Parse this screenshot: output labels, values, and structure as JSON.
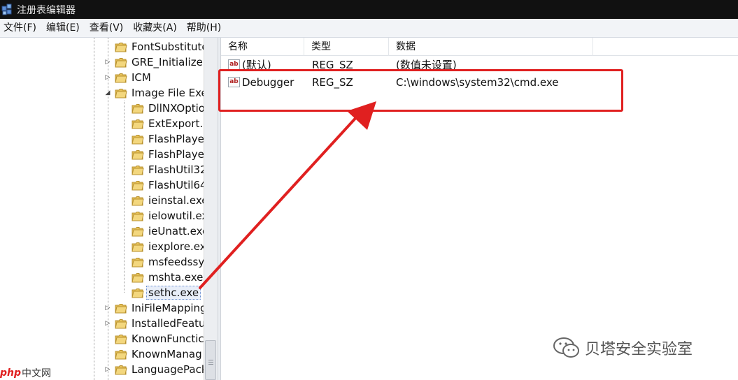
{
  "window": {
    "title": "注册表编辑器"
  },
  "menu": [
    "文件(F)",
    "编辑(E)",
    "查看(V)",
    "收藏夹(A)",
    "帮助(H)"
  ],
  "tree": {
    "items": [
      {
        "label": "FontSubstitute",
        "level": 1,
        "expander": "none"
      },
      {
        "label": "GRE_Initialize",
        "level": 1,
        "expander": "collapsed"
      },
      {
        "label": "ICM",
        "level": 1,
        "expander": "collapsed"
      },
      {
        "label": "Image File Exe",
        "level": 1,
        "expander": "expanded"
      },
      {
        "label": "DllNXOptio",
        "level": 2,
        "expander": "none"
      },
      {
        "label": "ExtExport.e",
        "level": 2,
        "expander": "none"
      },
      {
        "label": "FlashPlayer",
        "level": 2,
        "expander": "none"
      },
      {
        "label": "FlashPlayer",
        "level": 2,
        "expander": "none"
      },
      {
        "label": "FlashUtil32",
        "level": 2,
        "expander": "none"
      },
      {
        "label": "FlashUtil64",
        "level": 2,
        "expander": "none"
      },
      {
        "label": "ieinstal.exe",
        "level": 2,
        "expander": "none"
      },
      {
        "label": "ielowutil.ex",
        "level": 2,
        "expander": "none"
      },
      {
        "label": "ieUnatt.exe",
        "level": 2,
        "expander": "none"
      },
      {
        "label": "iexplore.ex",
        "level": 2,
        "expander": "none"
      },
      {
        "label": "msfeedssyn",
        "level": 2,
        "expander": "none"
      },
      {
        "label": "mshta.exe",
        "level": 2,
        "expander": "none"
      },
      {
        "label": "sethc.exe",
        "level": 2,
        "expander": "none",
        "selected": true
      },
      {
        "label": "IniFileMapping",
        "level": 1,
        "expander": "collapsed"
      },
      {
        "label": "InstalledFeatu",
        "level": 1,
        "expander": "collapsed"
      },
      {
        "label": "KnownFunctic",
        "level": 1,
        "expander": "none"
      },
      {
        "label": "KnownManag",
        "level": 1,
        "expander": "none"
      },
      {
        "label": "LanguagePack",
        "level": 1,
        "expander": "collapsed"
      }
    ]
  },
  "list": {
    "columns": [
      "名称",
      "类型",
      "数据"
    ],
    "rows": [
      {
        "name": "(默认)",
        "type": "REG_SZ",
        "data": "(数值未设置)",
        "icon": "string-value-icon"
      },
      {
        "name": "Debugger",
        "type": "REG_SZ",
        "data": "C:\\windows\\system32\\cmd.exe",
        "icon": "string-value-icon"
      }
    ],
    "icon_text": "ab"
  },
  "colors": {
    "annotation": "#e02020",
    "folder": "#e8c35a"
  },
  "watermark": {
    "text": "贝塔安全实验室"
  },
  "site_logo": {
    "mark": "php",
    "text": "中文网"
  }
}
